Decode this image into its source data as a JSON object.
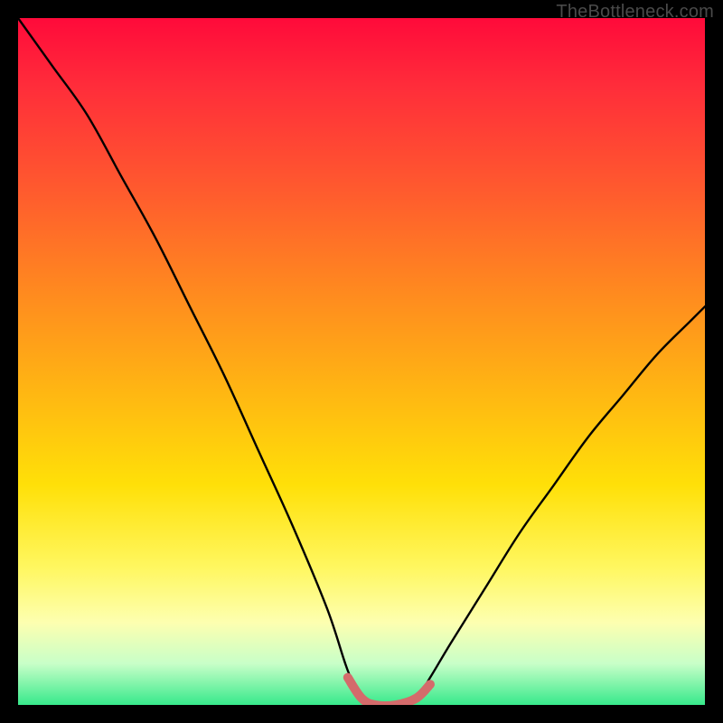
{
  "attribution": "TheBottleneck.com",
  "chart_data": {
    "type": "line",
    "title": "",
    "xlabel": "",
    "ylabel": "",
    "xlim": [
      0,
      100
    ],
    "ylim": [
      0,
      100
    ],
    "background_gradient_meaning": "bottleneck percentage (red high, green low)",
    "series": [
      {
        "name": "bottleneck-curve",
        "color": "#000000",
        "x": [
          0,
          5,
          10,
          15,
          20,
          25,
          30,
          35,
          40,
          45,
          48,
          50,
          52,
          55,
          58,
          60,
          63,
          68,
          73,
          78,
          83,
          88,
          93,
          98,
          100
        ],
        "values": [
          100,
          93,
          86,
          77,
          68,
          58,
          48,
          37,
          26,
          14,
          5,
          1,
          0,
          0,
          1,
          4,
          9,
          17,
          25,
          32,
          39,
          45,
          51,
          56,
          58
        ]
      },
      {
        "name": "optimal-band",
        "color": "#d46b6b",
        "x": [
          48,
          50,
          52,
          55,
          58,
          60
        ],
        "values": [
          4,
          1,
          0,
          0,
          1,
          3
        ]
      }
    ]
  }
}
